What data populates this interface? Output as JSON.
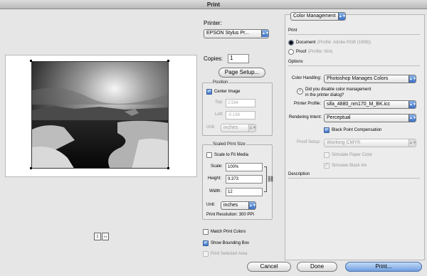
{
  "window": {
    "title": "Print"
  },
  "printer": {
    "label": "Printer:",
    "value": "EPSON Stylus Pr..."
  },
  "copies": {
    "label": "Copies:",
    "value": "1"
  },
  "page_setup": {
    "label": "Page Setup..."
  },
  "position": {
    "title": "Position",
    "center_image": {
      "label": "Center Image",
      "checked": true
    },
    "top": {
      "label": "Top:",
      "value": "2.594"
    },
    "left": {
      "label": "Left:",
      "value": "-0.159"
    },
    "unit": {
      "label": "Unit:",
      "value": "inches"
    }
  },
  "scaled": {
    "title": "Scaled Print Size",
    "scale_to_fit": {
      "label": "Scale to Fit Media",
      "checked": false
    },
    "scale": {
      "label": "Scale:",
      "value": "100%"
    },
    "height": {
      "label": "Height:",
      "value": "9.373"
    },
    "width": {
      "label": "Width:",
      "value": "12"
    },
    "unit": {
      "label": "Unit:",
      "value": "inches"
    },
    "resolution": "Print Resolution: 300 PPI"
  },
  "options_left": {
    "match_print_colors": "Match Print Colors",
    "show_bounding_box": "Show Bounding Box",
    "print_selected_area": "Print Selected Area"
  },
  "orientation": {
    "portrait": "↕",
    "landscape": "↔"
  },
  "color_management": {
    "dropdown": "Color Management",
    "print_label": "Print",
    "document_label": "Document",
    "document_profile": "(Profile: Adobe RGB (1998))",
    "proof_label": "Proof",
    "proof_profile": "(Profile: N/A)",
    "options_label": "Options",
    "color_handling_label": "Color Handling:",
    "color_handling_value": "Photoshop Manages Colors",
    "info_text": "Did you disable color management in the printer dialog?",
    "printer_profile_label": "Printer Profile:",
    "printer_profile_value": "sifa_4880_nm170_M_BK.icc",
    "rendering_intent_label": "Rendering Intent:",
    "rendering_intent_value": "Perceptual",
    "black_point": "Black Point Compensation",
    "proof_setup_label": "Proof Setup:",
    "proof_setup_value": "Working CMYK",
    "simulate_paper": "Simulate Paper Color",
    "simulate_ink": "Simulate Black Ink",
    "description_label": "Description"
  },
  "buttons": {
    "cancel": "Cancel",
    "done": "Done",
    "print": "Print..."
  }
}
